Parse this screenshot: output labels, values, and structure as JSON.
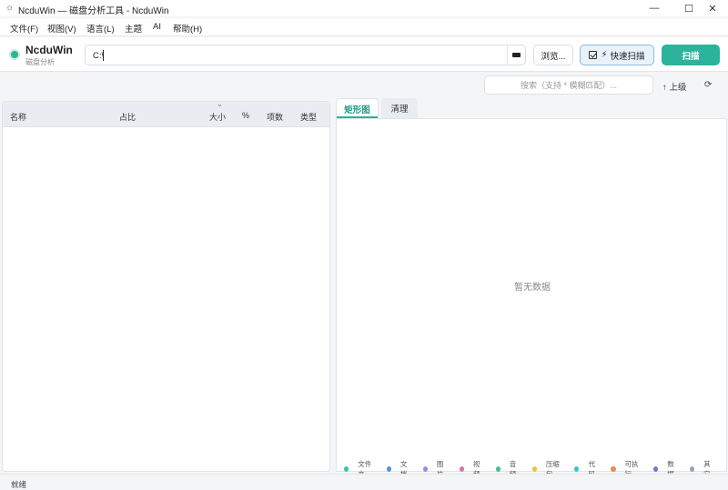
{
  "window": {
    "title": "NcduWin — 磁盘分析工具 - NcduWin",
    "minimize": "—",
    "maximize": "☐",
    "close": "✕"
  },
  "menu": [
    "文件(F)",
    "视图(V)",
    "语言(L)",
    "主题",
    "AI",
    "帮助(H)"
  ],
  "brand": {
    "name": "NcduWin",
    "subtitle": "磁盘分析"
  },
  "path": {
    "value": "C:\\"
  },
  "toolbar": {
    "browse_label": "浏览...",
    "quick_scan_label": "快速扫描",
    "quick_scan_checked": true,
    "scan_label": "扫描"
  },
  "search": {
    "placeholder": "搜索（支持 * 模糊匹配）..."
  },
  "nav": {
    "up_label": "↑ 上级",
    "refresh_icon": "⟳"
  },
  "table": {
    "sort_icon": "⌄",
    "columns": [
      "名称",
      "占比",
      "大小",
      "%",
      "项数",
      "类型"
    ]
  },
  "tabs": {
    "treemap": "矩形图",
    "clean": "清理"
  },
  "chart": {
    "empty_text": "暂无数据"
  },
  "legend": [
    {
      "label": "文件夹",
      "color": "#36c4a8"
    },
    {
      "label": "文档",
      "color": "#5b8fe0"
    },
    {
      "label": "图片",
      "color": "#9b8ae0"
    },
    {
      "label": "视频",
      "color": "#e06fa8"
    },
    {
      "label": "音频",
      "color": "#3cc48f"
    },
    {
      "label": "压缩包",
      "color": "#f0c040"
    },
    {
      "label": "代码",
      "color": "#2ec8d0"
    },
    {
      "label": "可执行",
      "color": "#f08a4a"
    },
    {
      "label": "数据",
      "color": "#6a78d8"
    },
    {
      "label": "其它",
      "color": "#9aa3ad"
    }
  ],
  "status": {
    "text": "就绪"
  }
}
